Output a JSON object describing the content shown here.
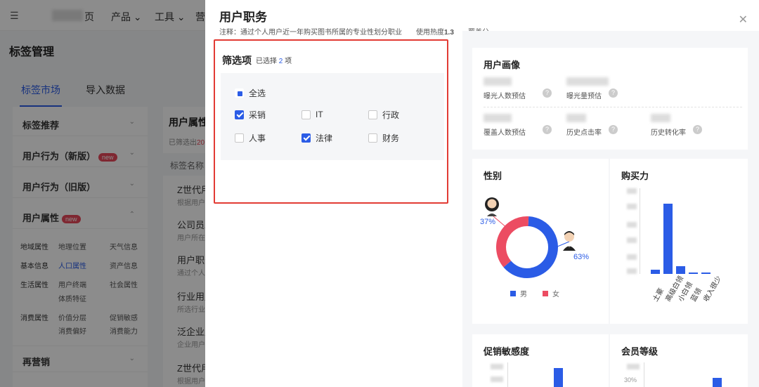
{
  "background": {
    "logo": "☰",
    "nav_suffix": "页",
    "nav": [
      "产品 ⌄",
      "工具 ⌄",
      "营"
    ],
    "page_title": "标签管理",
    "tabs": [
      "标签市场",
      "导入数据"
    ],
    "sidebar": {
      "groups": [
        {
          "label": "标签推荐"
        },
        {
          "label": "用户行为（新版）",
          "badge": "new"
        },
        {
          "label": "用户行为（旧版）"
        },
        {
          "label": "用户属性",
          "badge": "new"
        },
        {
          "label": "再营销"
        }
      ],
      "categories": [
        "地域属性",
        "基本信息",
        "生活属性",
        "消费属性"
      ],
      "subitems": [
        "地理位置",
        "天气信息",
        "人口属性",
        "资产信息",
        "用户终端",
        "社会属性",
        "体质特征",
        "价值分层",
        "促销敏感",
        "消费偏好",
        "消费能力"
      ]
    },
    "middle": {
      "heading": "用户属性",
      "selected_prefix": "已筛选出",
      "selected_num": "20",
      "col_header": "标签名称",
      "rows": [
        {
          "title": "Z世代用户",
          "sub": "根据用户"
        },
        {
          "title": "公司员工",
          "sub": "用户所在"
        },
        {
          "title": "用户职务",
          "sub": "通过个人"
        },
        {
          "title": "行业用户",
          "sub": "所选行业"
        },
        {
          "title": "泛企业用户",
          "sub": "企业用户"
        },
        {
          "title": "Z世代用户",
          "sub": "根据用户"
        }
      ]
    }
  },
  "drawer": {
    "title": "用户职务",
    "note": "注释：通过个人用户近一年购买图书所属的专业性划分职业",
    "heat_label": "使用热度",
    "heat_value": "1.3",
    "cover_label": "覆盖分",
    "cover_value": "--",
    "close_icon": "✕",
    "filter": {
      "heading": "筛选项",
      "count_prefix": "已选择",
      "count": "2",
      "count_suffix": "项",
      "options": [
        {
          "label": "全选",
          "state": "partial"
        },
        {
          "label": "采销",
          "state": "checked"
        },
        {
          "label": "IT",
          "state": "unchecked"
        },
        {
          "label": "行政",
          "state": "unchecked"
        },
        {
          "label": "人事",
          "state": "unchecked"
        },
        {
          "label": "法律",
          "state": "checked"
        },
        {
          "label": "财务",
          "state": "unchecked"
        }
      ]
    },
    "portrait": {
      "heading": "用户画像",
      "stats": [
        "曝光人数预估",
        "曝光量预估",
        "覆盖人数预估",
        "历史点击率",
        "历史转化率"
      ],
      "help_icon": "?"
    },
    "gender": {
      "heading": "性别",
      "female_pct": "37%",
      "male_pct": "63%",
      "male_label": "男",
      "female_label": "女",
      "male_color": "#2b5ce6",
      "female_color": "#ec4c62"
    },
    "purchase": {
      "heading": "购买力",
      "categories": [
        "土豪",
        "高级白领",
        "小白领",
        "蓝领",
        "收入很少"
      ],
      "values": [
        4,
        63,
        7,
        1,
        1
      ]
    },
    "promo": {
      "heading": "促销敏感度"
    },
    "member": {
      "heading": "会员等级",
      "tick": "30%"
    }
  }
}
